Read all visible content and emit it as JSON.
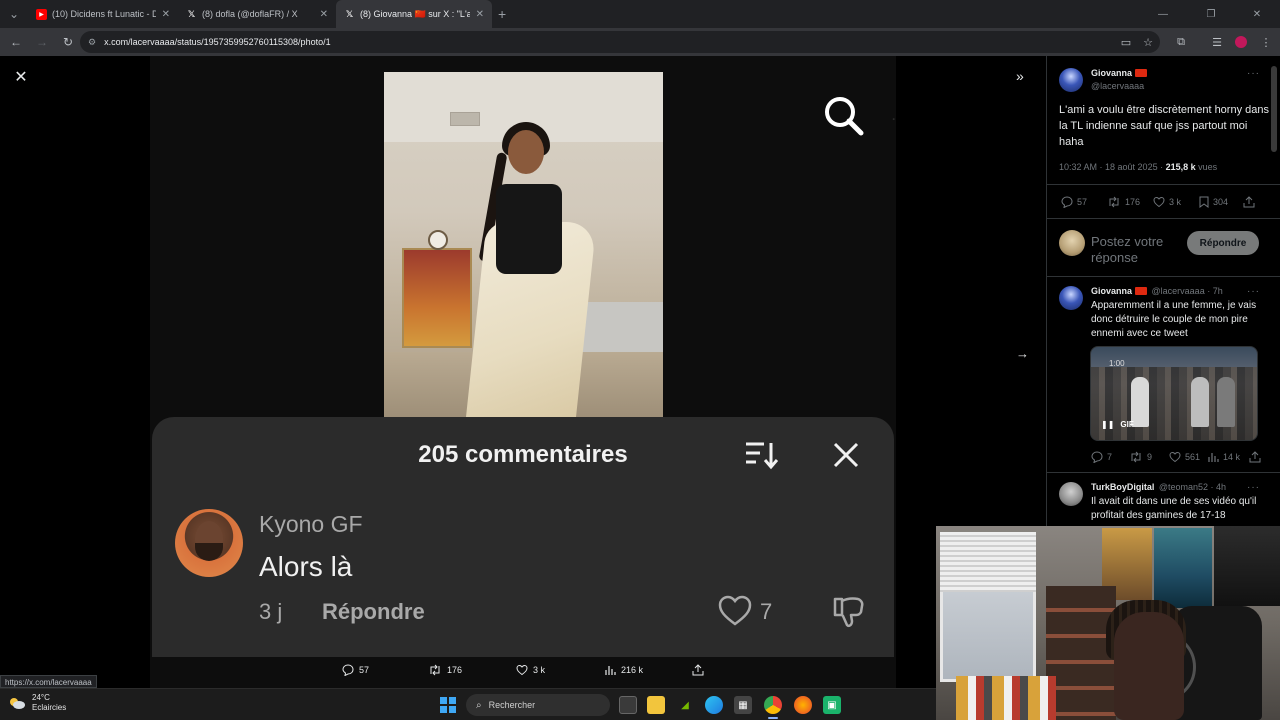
{
  "browser": {
    "tabs": [
      {
        "label": "(10) Dicidens ft Lunatic - De la…",
        "favicon": "youtube-icon",
        "color": "#ff0000",
        "active": false
      },
      {
        "label": "(8) dofla (@doflaFR) / X",
        "favicon": "x-icon",
        "color": "#ffffff",
        "active": false
      },
      {
        "label": "(8) Giovanna 🇨🇳 sur X : \"L'ami a…",
        "favicon": "x-icon",
        "color": "#ffffff",
        "active": true
      }
    ],
    "url": "x.com/lacervaaaa/status/1957359952760115308/photo/1",
    "status_url": "https://x.com/lacervaaaa"
  },
  "media": {
    "comments_overlay": {
      "title": "205 commentaires",
      "comment": {
        "author": "Kyono GF",
        "text": "Alors là",
        "age": "3 j",
        "reply_label": "Répondre",
        "likes": "7"
      }
    },
    "actions": {
      "replies": "57",
      "reposts": "176",
      "likes": "3 k",
      "views": "216 k"
    }
  },
  "tweet": {
    "author": "Giovanna",
    "handle": "@lacervaaaa",
    "text": "L'ami a voulu être discrètement horny dans la TL indienne sauf que jss partout moi haha",
    "time": "10:32 AM · 18 août 2025 · ",
    "views_count": "215,8 k",
    "views_label": " vues",
    "stats": {
      "replies": "57",
      "reposts": "176",
      "likes": "3 k",
      "bookmarks": "304"
    },
    "reply_placeholder": "Postez votre réponse",
    "reply_button": "Répondre"
  },
  "replies": [
    {
      "author": "Giovanna",
      "handle": "@lacervaaaa · 7h",
      "text": "Apparemment il a une femme, je vais donc détruire le couple de mon pire ennemi avec ce tweet",
      "gif_label": "GIF",
      "gif_time": "1:00",
      "stats": {
        "replies": "7",
        "reposts": "9",
        "likes": "561",
        "views": "14 k"
      }
    },
    {
      "author": "TurkBoyDigital",
      "handle": "@teoman52 · 4h",
      "text": "Il avait dit dans une de ses vidéo qu'il profitait des gamines de 17-18"
    }
  ],
  "taskbar": {
    "weather_temp": "24°C",
    "weather_desc": "Eclaircies",
    "search_placeholder": "Rechercher"
  }
}
